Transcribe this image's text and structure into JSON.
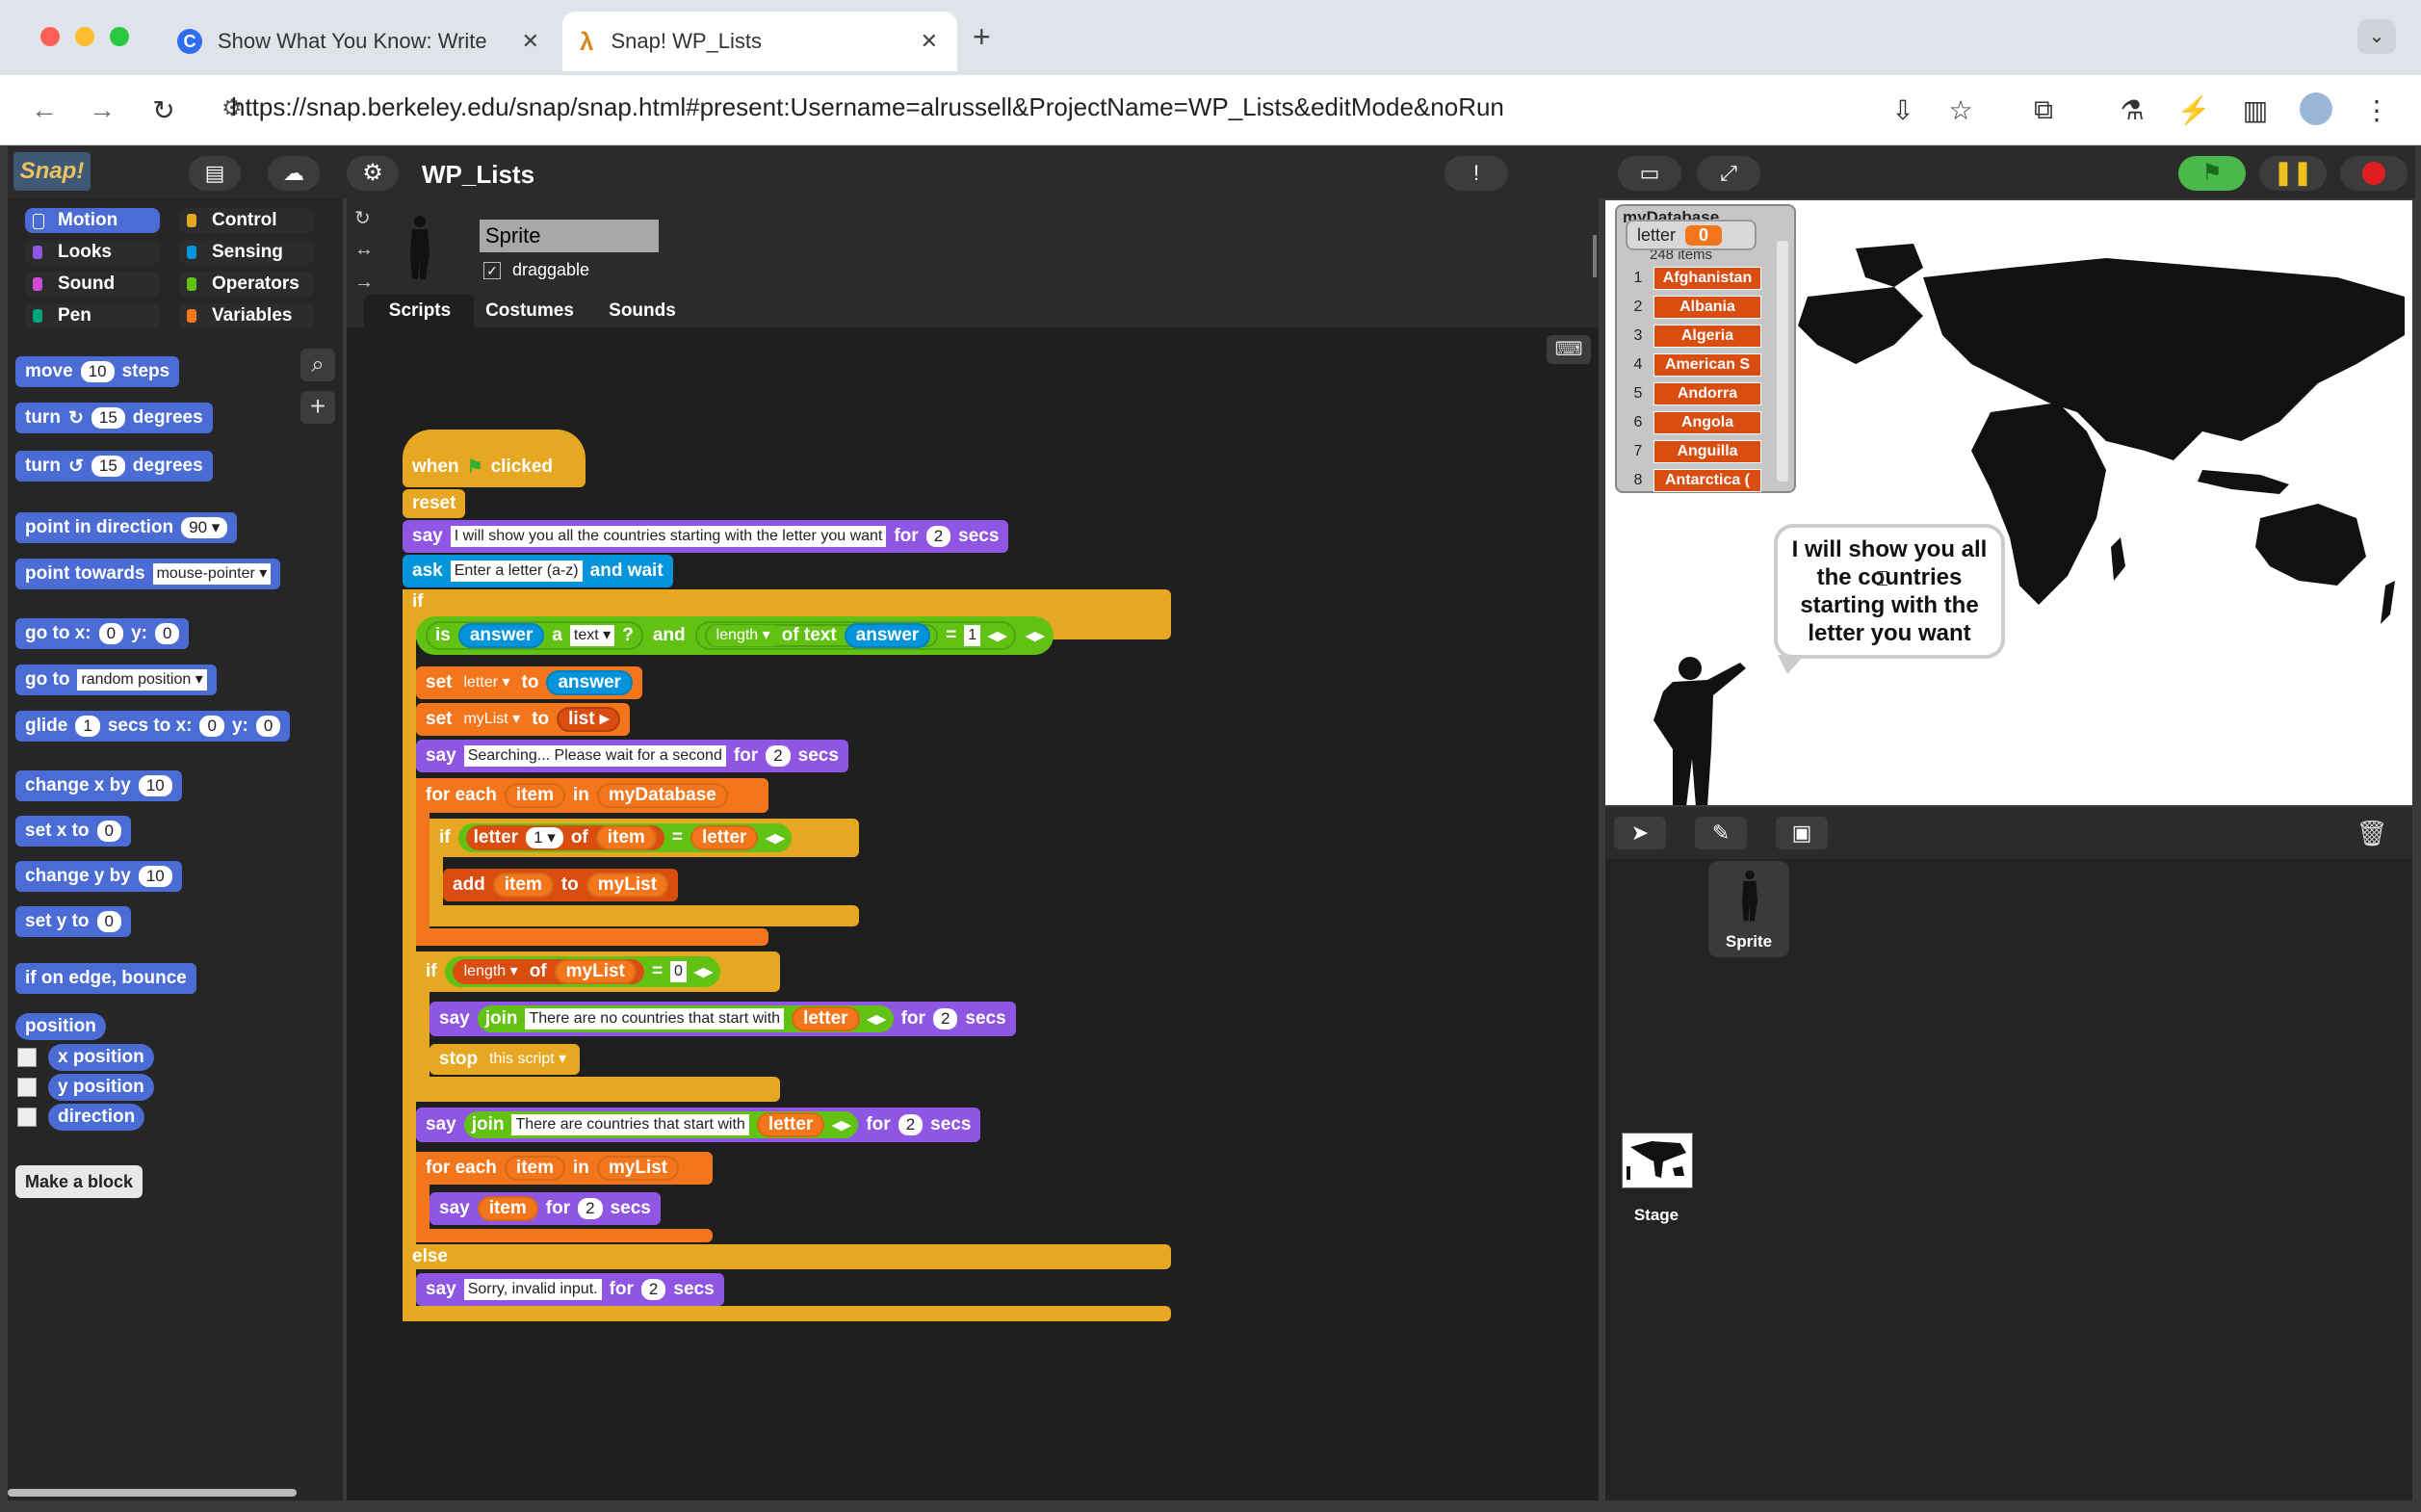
{
  "browser": {
    "tabs": [
      {
        "title": "Show What You Know: Write",
        "icon": "c-icon"
      },
      {
        "title": "Snap! WP_Lists",
        "icon": "lambda-icon"
      }
    ],
    "url": "https://snap.berkeley.edu/snap/snap.html#present:Username=alrussell&ProjectName=WP_Lists&editMode&noRun"
  },
  "snap": {
    "logo": "Snap!",
    "project_name": "WP_Lists",
    "categories": [
      "Motion",
      "Looks",
      "Sound",
      "Pen",
      "Control",
      "Sensing",
      "Operators",
      "Variables"
    ],
    "sprite": {
      "name": "Sprite",
      "draggable_label": "draggable"
    },
    "tabs": [
      "Scripts",
      "Costumes",
      "Sounds"
    ],
    "palette": {
      "move": "move",
      "move_val": "10",
      "steps": "steps",
      "turn": "turn",
      "turn_val": "15",
      "degrees": "degrees",
      "point_dir": "point in direction",
      "dir_val": "90",
      "point_towards": "point towards",
      "towards_val": "mouse-pointer",
      "goto_xy": "go to x:",
      "goto_x": "0",
      "y_label": "y:",
      "goto_y": "0",
      "goto": "go to",
      "goto_val": "random position",
      "glide": "glide",
      "glide_secs": "1",
      "secs_to_x": "secs to x:",
      "glide_x": "0",
      "glide_y": "0",
      "change_x": "change x by",
      "change_x_val": "10",
      "set_x": "set x to",
      "set_x_val": "0",
      "change_y": "change y by",
      "change_y_val": "10",
      "set_y": "set y to",
      "set_y_val": "0",
      "bounce": "if on edge, bounce",
      "position": "position",
      "x_position": "x position",
      "y_position": "y position",
      "direction": "direction",
      "make_block": "Make a block"
    },
    "script": {
      "when": "when",
      "clicked": "clicked",
      "reset": "reset",
      "say": "say",
      "for": "for",
      "secs": "secs",
      "two": "2",
      "say1": "I will show you all the countries starting with the letter you want",
      "ask": "ask",
      "ask_text": "Enter a letter (a-z)",
      "and_wait": "and wait",
      "if": "if",
      "is": "is",
      "answer": "answer",
      "a": "a",
      "text": "text",
      "q": "?",
      "and": "and",
      "length": "length",
      "of_text": "of text",
      "eq": "=",
      "one": "1",
      "set": "set",
      "letter": "letter",
      "to": "to",
      "mylist": "myList",
      "list": "list",
      "searching": "Searching... Please wait for a second",
      "for_each": "for each",
      "item": "item",
      "in": "in",
      "mydatabase": "myDatabase",
      "of": "of",
      "add": "add",
      "zero": "0",
      "join": "join",
      "no_countries": "There are no countries that start with",
      "stop": "stop",
      "this_script": "this script",
      "are_countries": "There are countries that start with",
      "else": "else",
      "sorry": "Sorry, invalid input."
    },
    "stage": {
      "letter_label": "letter",
      "letter_value": "0",
      "list_title": "myDatabase",
      "list_count": "248 items",
      "list_items": [
        {
          "n": "1",
          "v": "Afghanistan"
        },
        {
          "n": "2",
          "v": "Albania"
        },
        {
          "n": "3",
          "v": "Algeria"
        },
        {
          "n": "4",
          "v": "American S"
        },
        {
          "n": "5",
          "v": "Andorra"
        },
        {
          "n": "6",
          "v": "Angola"
        },
        {
          "n": "7",
          "v": "Anguilla"
        },
        {
          "n": "8",
          "v": "Antarctica ("
        }
      ],
      "speech": "I will show you all the countries starting with the letter you want"
    },
    "corral": {
      "sprite": "Sprite",
      "stage": "Stage"
    }
  }
}
